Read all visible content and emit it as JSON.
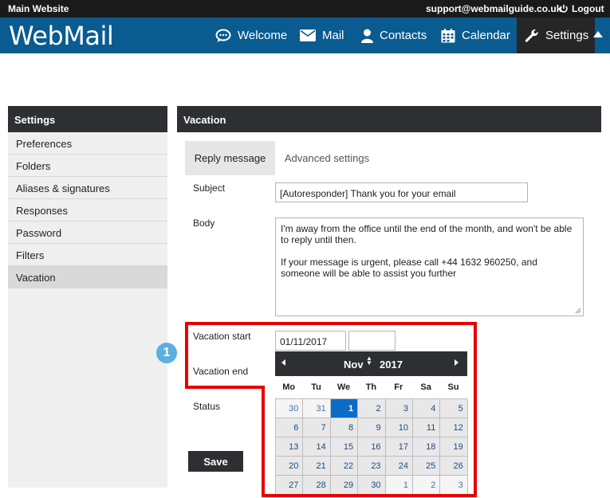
{
  "topbar": {
    "site": "Main Website",
    "email": "support@webmailguide.co.uk",
    "logout": "Logout"
  },
  "header": {
    "logo": "WebMail",
    "nav": [
      {
        "label": "Welcome",
        "icon": "chat-bubble-icon"
      },
      {
        "label": "Mail",
        "icon": "envelope-icon"
      },
      {
        "label": "Contacts",
        "icon": "user-icon"
      },
      {
        "label": "Calendar",
        "icon": "calendar-icon"
      },
      {
        "label": "Settings",
        "icon": "wrench-icon"
      }
    ]
  },
  "sidebar": {
    "title": "Settings",
    "items": [
      {
        "label": "Preferences"
      },
      {
        "label": "Folders"
      },
      {
        "label": "Aliases & signatures"
      },
      {
        "label": "Responses"
      },
      {
        "label": "Password"
      },
      {
        "label": "Filters"
      },
      {
        "label": "Vacation",
        "active": true
      }
    ]
  },
  "main": {
    "title": "Vacation",
    "tabs": [
      {
        "label": "Reply message",
        "active": true
      },
      {
        "label": "Advanced settings",
        "active": false
      }
    ],
    "form": {
      "subject_label": "Subject",
      "subject_value": "[Autoresponder] Thank you for your email",
      "body_label": "Body",
      "body_line1": "I'm away from the office until the end of the month, and won't be able to reply until then.",
      "body_line2": "If your message is urgent, please call +44 1632 960250, and someone will be able to assist you further",
      "vacation_start_label": "Vacation start",
      "vacation_start_date": "01/11/2017",
      "vacation_start_time": "",
      "vacation_end_label": "Vacation end",
      "status_label": "Status",
      "save_label": "Save"
    },
    "callout_number": "1"
  },
  "calendar": {
    "month": "Nov",
    "year": "2017",
    "weekdays": [
      "Mo",
      "Tu",
      "We",
      "Th",
      "Fr",
      "Sa",
      "Su"
    ],
    "days": [
      "30",
      "31",
      "1",
      "2",
      "3",
      "4",
      "5",
      "6",
      "7",
      "8",
      "9",
      "10",
      "11",
      "12",
      "13",
      "14",
      "15",
      "16",
      "17",
      "18",
      "19",
      "20",
      "21",
      "22",
      "23",
      "24",
      "25",
      "26",
      "27",
      "28",
      "29",
      "30",
      "1",
      "2",
      "3"
    ],
    "other_month_indices": [
      0,
      1,
      32,
      33,
      34
    ],
    "selected_index": 2
  },
  "colors": {
    "header_blue": "#0a5b8f",
    "highlight_red": "#e60000",
    "selected_day": "#0b6cc6",
    "callout_blue": "#5ab0de"
  }
}
